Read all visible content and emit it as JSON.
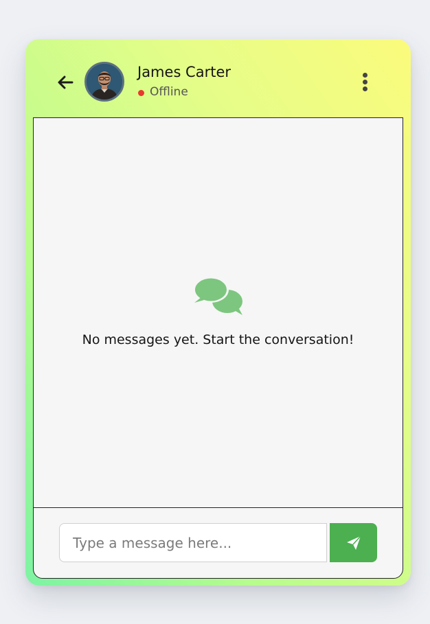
{
  "contact": {
    "name": "James Carter",
    "status": "Offline",
    "status_color": "#e8392f",
    "avatar_icon": "profile-photo"
  },
  "header": {
    "back_icon": "arrow-left-icon",
    "menu_icon": "vertical-dots-icon"
  },
  "messages": {
    "items": [],
    "empty_icon": "chat-bubbles-icon",
    "empty_text": "No messages yet. Start the conversation!"
  },
  "composer": {
    "placeholder": "Type a message here...",
    "value": "",
    "send_icon": "paper-plane-icon"
  },
  "colors": {
    "accent": "#4caf50",
    "empty_icon": "#7dc67f",
    "gradient_top": "#fbfb7c",
    "gradient_bottom": "#7df3a3"
  }
}
